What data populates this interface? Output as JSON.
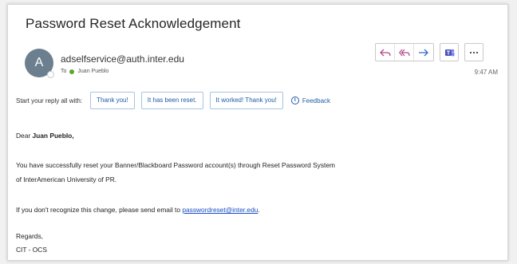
{
  "email": {
    "subject": "Password Reset Acknowledgement",
    "avatar_initial": "A",
    "sender": "adselfservice@auth.inter.edu",
    "to_label": "To",
    "to_name": "Juan Pueblo",
    "time": "9:47 AM"
  },
  "toolbar": {
    "icons": [
      "reply-icon",
      "reply-all-icon",
      "forward-icon",
      "teams-icon",
      "more-icon"
    ]
  },
  "quick_reply": {
    "label": "Start your reply all with:",
    "options": [
      "Thank you!",
      "It has been reset.",
      "It worked! Thank you!"
    ],
    "feedback": "Feedback"
  },
  "body": {
    "greeting_prefix": "Dear ",
    "greeting_name": "Juan Pueblo,",
    "line1": "You have successfully reset your Banner/Blackboard Password account(s) through Reset Password System",
    "line2": "of InterAmerican University of PR.",
    "line3_prefix": "If you don't recognize this change, please send email to ",
    "line3_link": "passwordreset@inter.edu",
    "line3_suffix": ".",
    "sign1": "Regards,",
    "sign2": "CIT - OCS"
  },
  "colors": {
    "accent": "#1f5fa8",
    "avatar": "#6b7f8e",
    "reply_icon": "#b04a8a",
    "teams": "#4b53bc"
  }
}
